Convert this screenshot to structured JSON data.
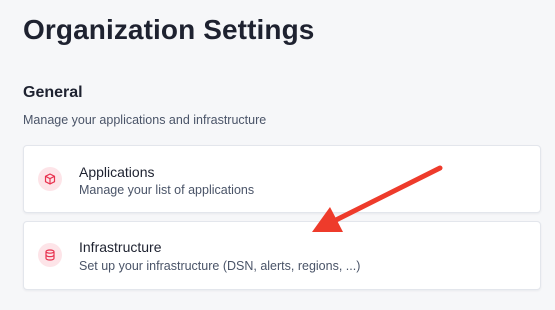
{
  "page": {
    "title": "Organization Settings"
  },
  "section": {
    "title": "General",
    "description": "Manage your applications and infrastructure"
  },
  "cards": [
    {
      "title": "Applications",
      "description": "Manage your list of applications",
      "icon": "cube-icon"
    },
    {
      "title": "Infrastructure",
      "description": "Set up your infrastructure (DSN, alerts, regions, ...)",
      "icon": "database-icon"
    }
  ],
  "colors": {
    "accent": "#e8324f",
    "icon_bg": "#fde4e8",
    "annotation_arrow": "#ee3b2b"
  }
}
